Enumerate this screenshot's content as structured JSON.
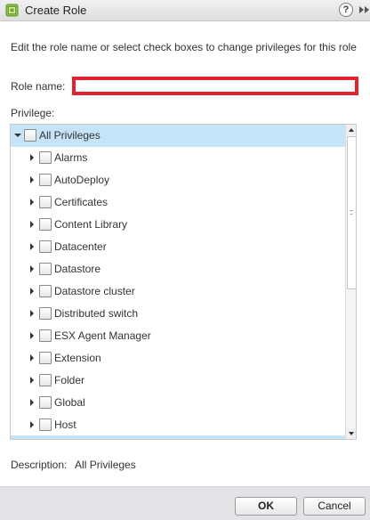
{
  "window": {
    "title": "Create Role",
    "help_label": "?",
    "icon": "vsphere-role-icon"
  },
  "instructions": "Edit the role name or select check boxes to change privileges for this role",
  "role_name": {
    "label": "Role name:",
    "value": "",
    "highlight_color": "#e0232e"
  },
  "privilege": {
    "label": "Privilege:",
    "root": {
      "label": "All Privileges",
      "expanded": true,
      "checked": false
    },
    "items": [
      {
        "label": "Alarms",
        "expanded": false,
        "checked": false
      },
      {
        "label": "AutoDeploy",
        "expanded": false,
        "checked": false
      },
      {
        "label": "Certificates",
        "expanded": false,
        "checked": false
      },
      {
        "label": "Content Library",
        "expanded": false,
        "checked": false
      },
      {
        "label": "Datacenter",
        "expanded": false,
        "checked": false
      },
      {
        "label": "Datastore",
        "expanded": false,
        "checked": false
      },
      {
        "label": "Datastore cluster",
        "expanded": false,
        "checked": false
      },
      {
        "label": "Distributed switch",
        "expanded": false,
        "checked": false
      },
      {
        "label": "ESX Agent Manager",
        "expanded": false,
        "checked": false
      },
      {
        "label": "Extension",
        "expanded": false,
        "checked": false
      },
      {
        "label": "Folder",
        "expanded": false,
        "checked": false
      },
      {
        "label": "Global",
        "expanded": false,
        "checked": false
      },
      {
        "label": "Host",
        "expanded": false,
        "checked": false
      }
    ],
    "selection_color": "#c5e4f7"
  },
  "description": {
    "label": "Description:",
    "value": "All Privileges"
  },
  "footer": {
    "ok_label": "OK",
    "cancel_label": "Cancel"
  }
}
